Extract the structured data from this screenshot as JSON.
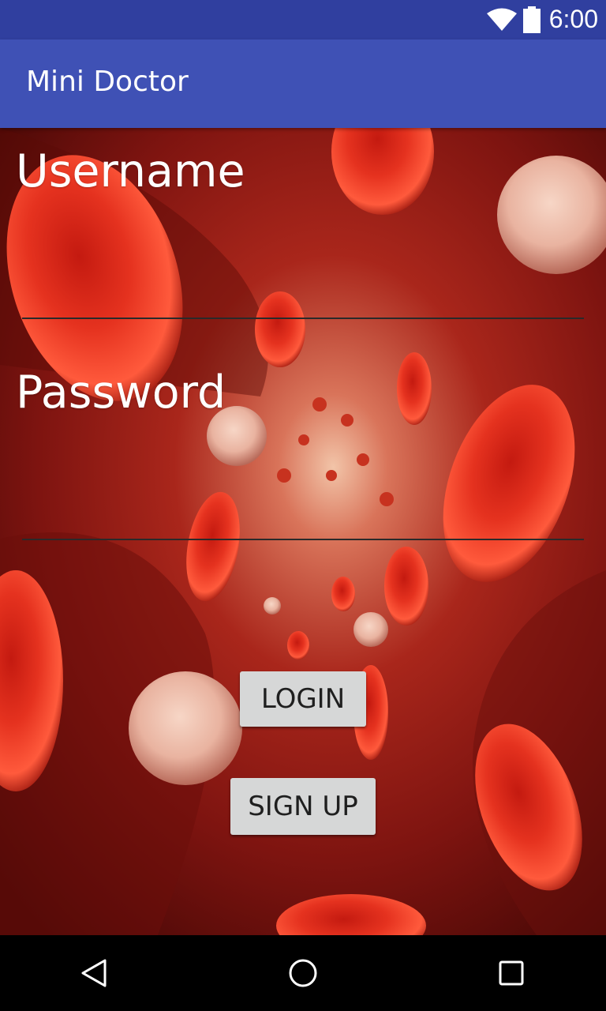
{
  "status_bar": {
    "time": "6:00",
    "icons": [
      "wifi-icon",
      "battery-icon"
    ]
  },
  "app_bar": {
    "title": "Mini Doctor"
  },
  "form": {
    "username_label": "Username",
    "username_value": "",
    "password_label": "Password",
    "password_value": ""
  },
  "buttons": {
    "login_label": "LOGIN",
    "signup_label": "SIGN UP"
  },
  "nav_bar": {
    "icons": [
      "back-icon",
      "home-icon",
      "recents-icon"
    ]
  },
  "colors": {
    "status_bar": "#303f9f",
    "app_bar": "#3f51b5",
    "background_red": "#a1150f",
    "button_bg": "#d6d7d7"
  }
}
